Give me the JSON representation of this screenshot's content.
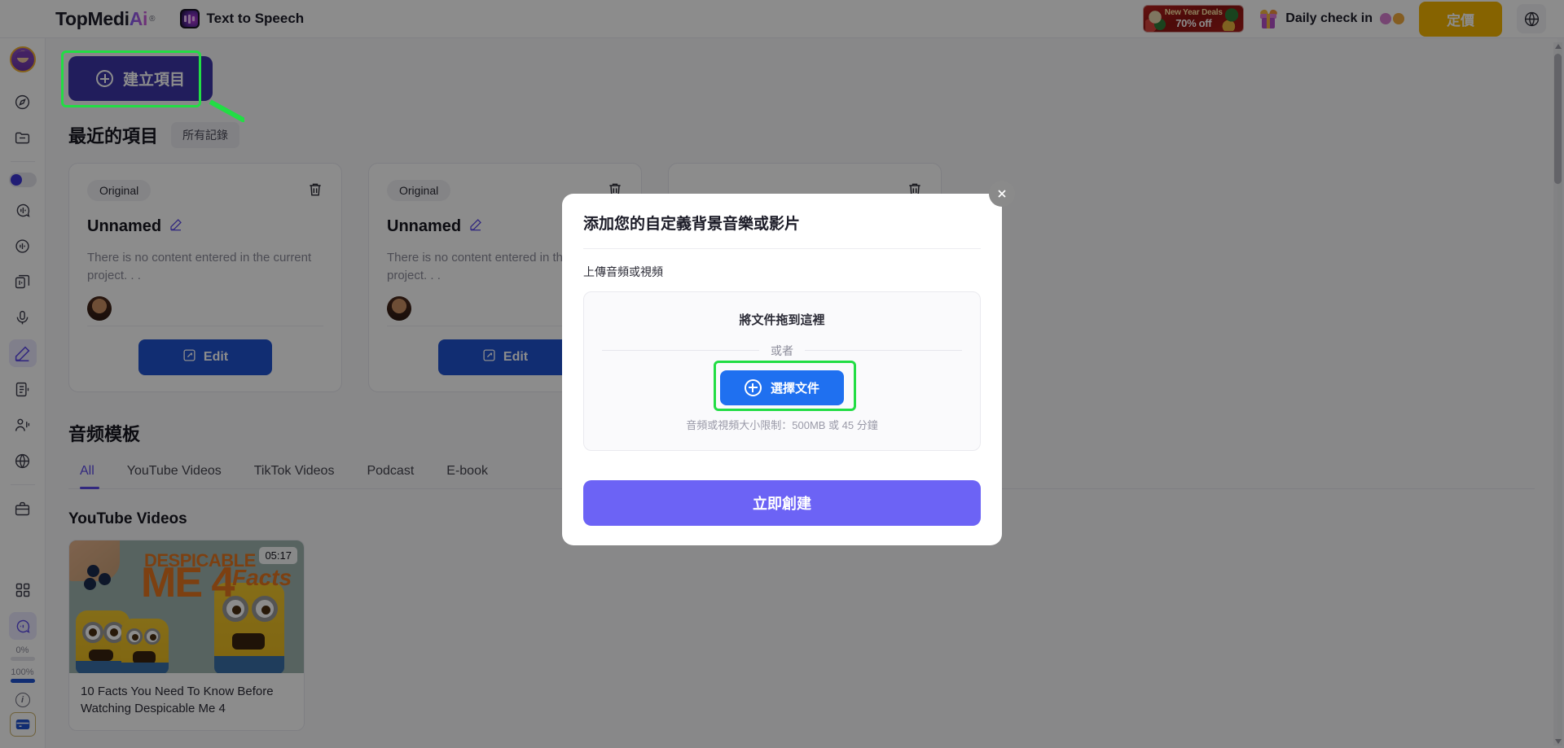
{
  "header": {
    "brand_top": "TopMedi",
    "brand_ai": "Ai",
    "brand_reg": "®",
    "app_name": "Text to Speech",
    "app_icon": "waveform-icon",
    "promo": {
      "line1": "New Year Deals",
      "line2": "70% off",
      "icon": "gift-banner-icon"
    },
    "checkin_label": "Daily check in",
    "checkin_icon": "gift-icon",
    "pricing_label": "定價",
    "language_icon": "globe-icon"
  },
  "sidebar": {
    "avatar_icon": "user-avatar",
    "items": [
      {
        "icon": "compass-icon",
        "active": false
      },
      {
        "icon": "folder-icon",
        "active": false
      },
      {
        "icon": "voice-changer-icon",
        "active": false
      },
      {
        "icon": "audio-wave-icon",
        "active": false
      },
      {
        "icon": "multi-file-icon",
        "active": false
      },
      {
        "icon": "microphone-icon",
        "active": false
      },
      {
        "icon": "pen-edit-icon",
        "active": true
      },
      {
        "icon": "document-audio-icon",
        "active": false
      },
      {
        "icon": "speaker-person-icon",
        "active": false
      },
      {
        "icon": "globe-translate-icon",
        "active": false
      },
      {
        "icon": "briefcase-icon",
        "active": false
      },
      {
        "icon": "grid-apps-icon",
        "active": false
      },
      {
        "icon": "chat-support-icon",
        "active": true
      }
    ],
    "usage_low_label": "0%",
    "usage_high_label": "100%",
    "info_icon": "info-icon",
    "card_icon": "credit-card-icon"
  },
  "main": {
    "create_project_label": "建立項目",
    "create_project_icon": "plus-circle-icon",
    "recent_title": "最近的項目",
    "all_records_label": "所有記錄",
    "projects": [
      {
        "badge": "Original",
        "title": "Unnamed",
        "description": "There is no content entered in the current project. . .",
        "edit_label": "Edit",
        "edit_icon": "pencil-square-icon",
        "delete_icon": "trash-icon",
        "rename_icon": "pencil-icon",
        "avatar_icon": "user-avatar"
      },
      {
        "badge": "Original",
        "title": "Unnamed",
        "description": "There is no content entered in the current project. . .",
        "edit_label": "Edit",
        "edit_icon": "pencil-square-icon",
        "delete_icon": "trash-icon",
        "rename_icon": "pencil-icon",
        "avatar_icon": "user-avatar"
      }
    ],
    "templates_title": "音频模板",
    "tabs": [
      {
        "label": "All",
        "active": true
      },
      {
        "label": "YouTube Videos",
        "active": false
      },
      {
        "label": "TikTok Videos",
        "active": false
      },
      {
        "label": "Podcast",
        "active": false
      },
      {
        "label": "E-book",
        "active": false
      }
    ],
    "youtube_section_title": "YouTube Videos",
    "video": {
      "thumb_kicker": "DESPICABLE",
      "thumb_title": "ME 4",
      "thumb_accent": "Facts",
      "duration": "05:17",
      "caption": "10 Facts You Need To Know Before Watching Despicable Me 4"
    }
  },
  "modal": {
    "title": "添加您的自定義背景音樂或影片",
    "close_icon": "close-icon",
    "upload_section_label": "上傳音頻或視頻",
    "drop_hint": "將文件拖到這裡",
    "or_label": "或者",
    "choose_file_label": "選擇文件",
    "choose_file_icon": "plus-circle-icon",
    "limit_text": "音頻或視頻大小限制：500MB 或 45 分鐘",
    "submit_label": "立即創建"
  },
  "annotations": {
    "highlight_color": "#22dd44",
    "boxes": [
      {
        "name": "create-project-button-highlight"
      },
      {
        "name": "choose-file-button-highlight"
      }
    ]
  }
}
